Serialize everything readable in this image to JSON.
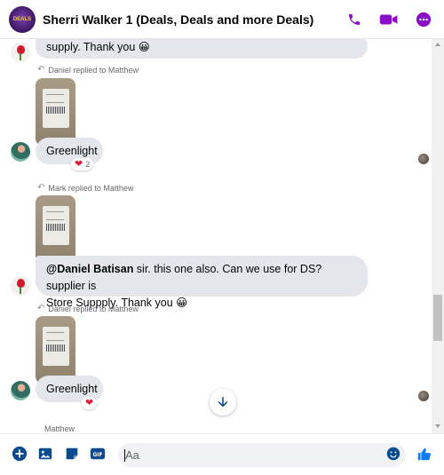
{
  "header": {
    "avatar_text": "DEALS",
    "title": "Sherri Walker 1 (Deals, Deals and more Deals)",
    "actions": [
      {
        "name": "phone-icon"
      },
      {
        "name": "video-icon"
      },
      {
        "name": "more-icon"
      }
    ]
  },
  "messages": {
    "m1_text": "supply. Thank you 😀",
    "reply1_note": "Daniel replied to Matthew",
    "m2_text": "Greenlight",
    "m2_reaction_count": "2",
    "reply2_note": "Mark replied to Matthew",
    "m3_mention": "@Daniel Batisan",
    "m3_line1": " sir. this one also. Can we use for DS? supplier is",
    "m3_line2": "Store Suppply. Thank you 😀",
    "reply3_note": "Daniel replied to Matthew",
    "m4_text": "Greenlight",
    "next_sender": "Matthew"
  },
  "composer": {
    "placeholder": "Aa"
  },
  "colors": {
    "accent": "#8b0fc7",
    "like": "#0a7cff",
    "bubble": "#e4e6eb",
    "heart": "#e41e3f"
  }
}
